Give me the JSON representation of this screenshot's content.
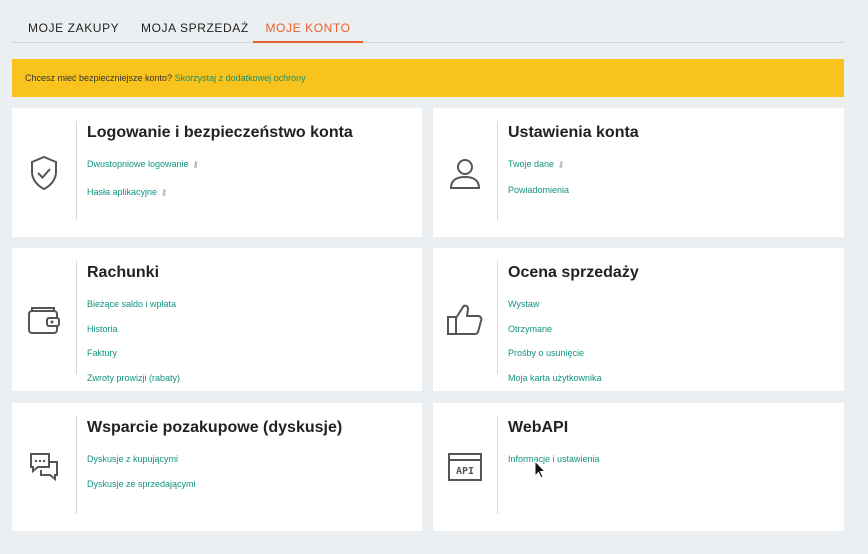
{
  "tabs": [
    {
      "label": "MOJE ZAKUPY",
      "active": false
    },
    {
      "label": "MOJA SPRZEDAŻ",
      "active": false
    },
    {
      "label": "MOJE KONTO",
      "active": true
    }
  ],
  "banner": {
    "text": "Chcesz mieć bezpieczniejsze konto?",
    "link": "Skorzystaj z dodatkowej ochrony"
  },
  "cards": {
    "security": {
      "title": "Logowanie i bezpieczeństwo konta",
      "icon": "shield-check-icon",
      "links": [
        "Dwustopniowe logowanie",
        "Hasła aplikacyjne"
      ]
    },
    "settings": {
      "title": "Ustawienia konta",
      "icon": "user-icon",
      "links": [
        "Twoje dane",
        "Powiadomienia"
      ]
    },
    "bills": {
      "title": "Rachunki",
      "icon": "wallet-icon",
      "links": [
        "Bieżące saldo i wpłata",
        "Historia",
        "Faktury",
        "Zwroty prowizji (rabaty)"
      ]
    },
    "rating": {
      "title": "Ocena sprzedaży",
      "icon": "thumbs-up-icon",
      "links": [
        "Wystaw",
        "Otrzymane",
        "Prośby o usunięcie",
        "Moja karta użytkownika"
      ]
    },
    "support": {
      "title": "Wsparcie pozakupowe (dyskusje)",
      "icon": "chat-bubbles-icon",
      "links": [
        "Dyskusje z kupującymi",
        "Dyskusje ze sprzedającymi"
      ]
    },
    "webapi": {
      "title": "WebAPI",
      "icon": "api-window-icon",
      "links": [
        "Informacje i ustawienia"
      ]
    }
  },
  "colors": {
    "accent": "#e9602a",
    "banner": "#f9c31d",
    "link": "#0f9480",
    "background": "#eceff1"
  }
}
